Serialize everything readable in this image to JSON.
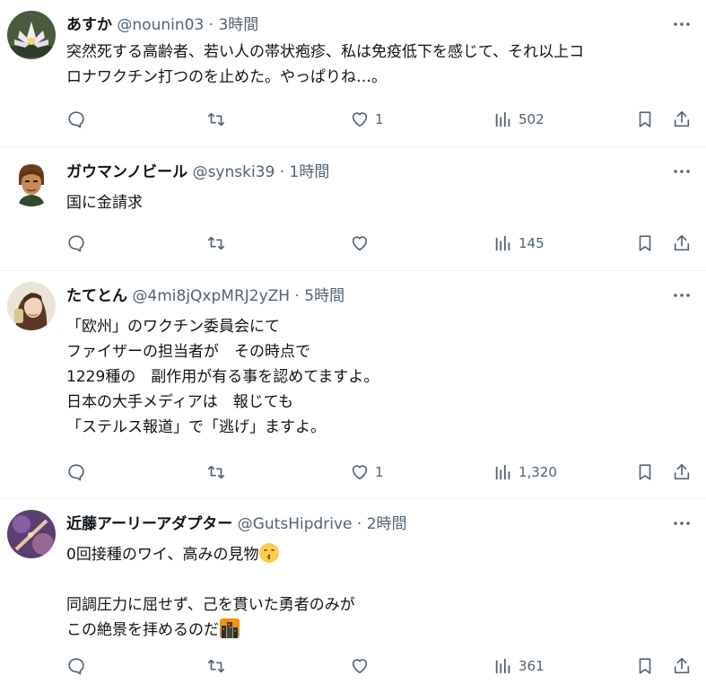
{
  "tweets": [
    {
      "name": "あすか",
      "handle": "@nounin03",
      "time": "3時間",
      "lines": [
        "突然死する高齢者、若い人の帯状疱疹、私は免疫低下を感じて、それ以上コ",
        "ロナワクチン打つのを止めた。やっぱりね…。"
      ],
      "likes": "1",
      "views": "502"
    },
    {
      "name": "ガウマンノビール",
      "handle": "@synski39",
      "time": "1時間",
      "lines": [
        "国に金請求"
      ],
      "likes": "",
      "views": "145"
    },
    {
      "name": "たてとん",
      "handle": "@4mi8jQxpMRJ2yZH",
      "time": "5時間",
      "lines": [
        "「欧州」のワクチン委員会にて",
        "ファイザーの担当者が　その時点で",
        "1229種の　副作用が有る事を認めてますよ。",
        "日本の大手メディアは　報じても",
        "「ステルス報道」で「逃げ」ますよ。"
      ],
      "likes": "1",
      "views": "1,320"
    },
    {
      "name": "近藤アーリーアダプター",
      "handle": "@GutsHipdrive",
      "time": "2時間",
      "lines": [
        "0回接種のワイ、高みの見物",
        "",
        "同調圧力に屈せず、己を貫いた勇者のみが",
        "この絶景を拝めるのだ"
      ],
      "likes": "",
      "views": "361"
    }
  ],
  "separator": " · ",
  "icons": {
    "reply": "reply-icon",
    "retweet": "retweet-icon",
    "like": "heart-icon",
    "views": "views-chart-icon",
    "bookmark": "bookmark-icon",
    "share": "share-icon",
    "more": "more-dots-icon"
  },
  "emojis": {
    "kissing": "kissing-face-emoji",
    "cityscape": "cityscape-dusk-emoji"
  },
  "colors": {
    "text": "#0f1419",
    "secondary": "#536471",
    "divider": "#eff3f4"
  }
}
